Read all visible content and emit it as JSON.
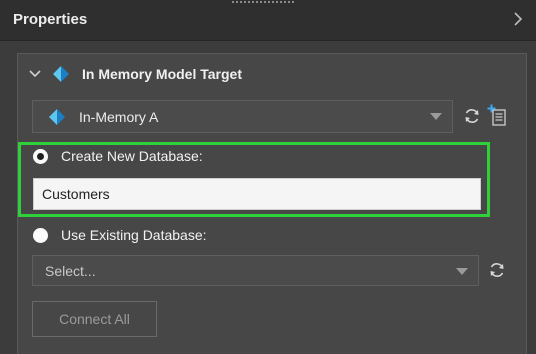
{
  "header": {
    "title": "Properties",
    "collapse_icon": "chevron-right-icon"
  },
  "section": {
    "title": "In Memory Model Target",
    "expand_icon": "chevron-down-icon",
    "model_icon": "in-memory-model-icon"
  },
  "target_combo": {
    "value": "In-Memory A",
    "icon": "in-memory-model-icon"
  },
  "actions": {
    "refresh_icon": "refresh-icon",
    "add_model_icon": "add-model-icon"
  },
  "create_new": {
    "label": "Create New Database:",
    "selected": true,
    "database_name": "Customers",
    "highlight_color": "#2fd13a"
  },
  "use_existing": {
    "label": "Use Existing Database:",
    "selected": false,
    "select_placeholder": "Select..."
  },
  "connect_button": {
    "label": "Connect All",
    "enabled": false
  }
}
